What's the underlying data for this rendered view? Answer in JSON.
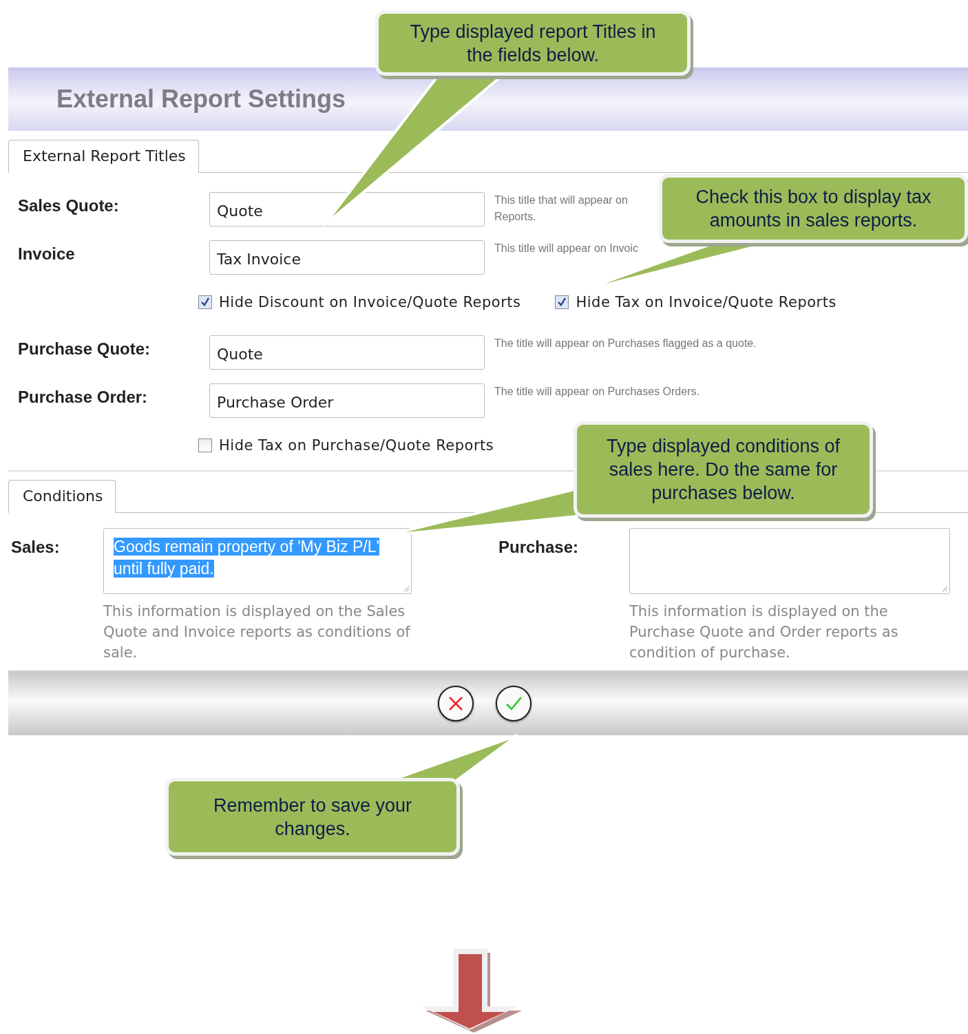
{
  "header": {
    "title": "External Report Settings"
  },
  "report_titles": {
    "tab": {
      "label": "External Report Titles"
    },
    "rows": [
      {
        "label": "Sales Quote:",
        "value": "Quote",
        "hint": "This title that will appear on Reports."
      },
      {
        "label": "Invoice",
        "value": "Tax Invoice",
        "hint": "This title will appear on Invoic"
      }
    ],
    "checkboxes": [
      {
        "label": "Hide Discount on Invoice/Quote Reports",
        "checked": true
      },
      {
        "label": "Hide Tax on Invoice/Quote Reports",
        "checked": true
      }
    ]
  },
  "purchase_titles": {
    "rows": [
      {
        "label": "Purchase Quote:",
        "value": "Quote",
        "hint": "The title will appear on Purchases flagged as a quote."
      },
      {
        "label": "Purchase Order:",
        "value": "Purchase Order",
        "hint": "The title will appear on Purchases Orders."
      }
    ],
    "checkboxes": [
      {
        "label": "Hide Tax on Purchase/Quote Reports",
        "checked": false
      }
    ]
  },
  "conditions": {
    "tab": {
      "label": "Conditions"
    },
    "fields": [
      {
        "label": "Sales:",
        "value": "Goods remain property of 'My Biz P/L' until fully paid.",
        "highlighted": true,
        "hint": "This information is displayed on the Sales Quote and Invoice reports as conditions of sale."
      },
      {
        "label": "Purchase:",
        "hint": "This information is displayed on the Purchase Quote and Order reports as condition of purchase."
      }
    ]
  },
  "footer_buttons": [
    {
      "kind": "cancel"
    },
    {
      "kind": "save"
    }
  ],
  "callouts": [
    {
      "text": "Type displayed report Titles in the fields below."
    },
    {
      "text": "Check this box to display tax amounts in sales reports."
    },
    {
      "text": "Type displayed conditions of sales here. Do the same for purchases below."
    },
    {
      "text": "Remember to save your changes."
    }
  ]
}
